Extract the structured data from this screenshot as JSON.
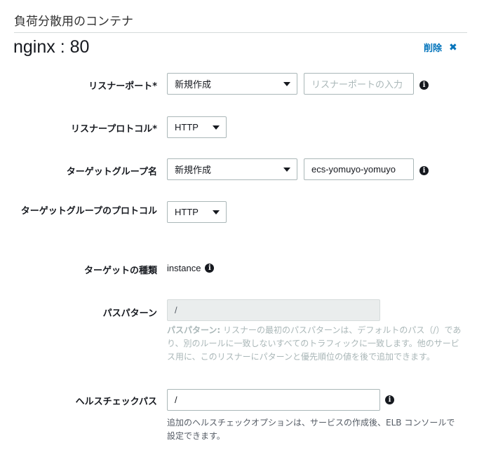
{
  "section": {
    "title": "負荷分散用のコンテナ"
  },
  "container": {
    "name": "nginx : 80",
    "delete_label": "削除",
    "delete_icon": "close-icon"
  },
  "form": {
    "listener_port": {
      "label": "リスナーポート*",
      "select_value": "新規作成",
      "input_placeholder": "リスナーポートの入力"
    },
    "listener_protocol": {
      "label": "リスナープロトコル*",
      "select_value": "HTTP"
    },
    "target_group_name": {
      "label": "ターゲットグループ名",
      "select_value": "新規作成",
      "input_value": "ecs-yomuyo-yomuyo"
    },
    "target_group_protocol": {
      "label": "ターゲットグループのプロトコル",
      "select_value": "HTTP"
    },
    "target_type": {
      "label": "ターゲットの種類",
      "value": "instance"
    },
    "path_pattern": {
      "label": "パスパターン",
      "input_value": "/",
      "help_term": "パスパターン:",
      "help_text": " リスナーの最初のパスパターンは、デフォルトのパス（/）であり、別のルールに一致しないすべてのトラフィックに一致します。他のサービス用に、このリスナーにパターンと優先順位の値を後で追加できます。"
    },
    "health_check_path": {
      "label": "ヘルスチェックパス",
      "input_value": "/",
      "help_text": "追加のヘルスチェックオプションは、サービスの作成後、ELB コンソールで設定できます。"
    }
  },
  "colors": {
    "link": "#0073bb",
    "border": "#aab7b8",
    "disabled_bg": "#eaeded",
    "muted_text": "#aab7b8"
  }
}
